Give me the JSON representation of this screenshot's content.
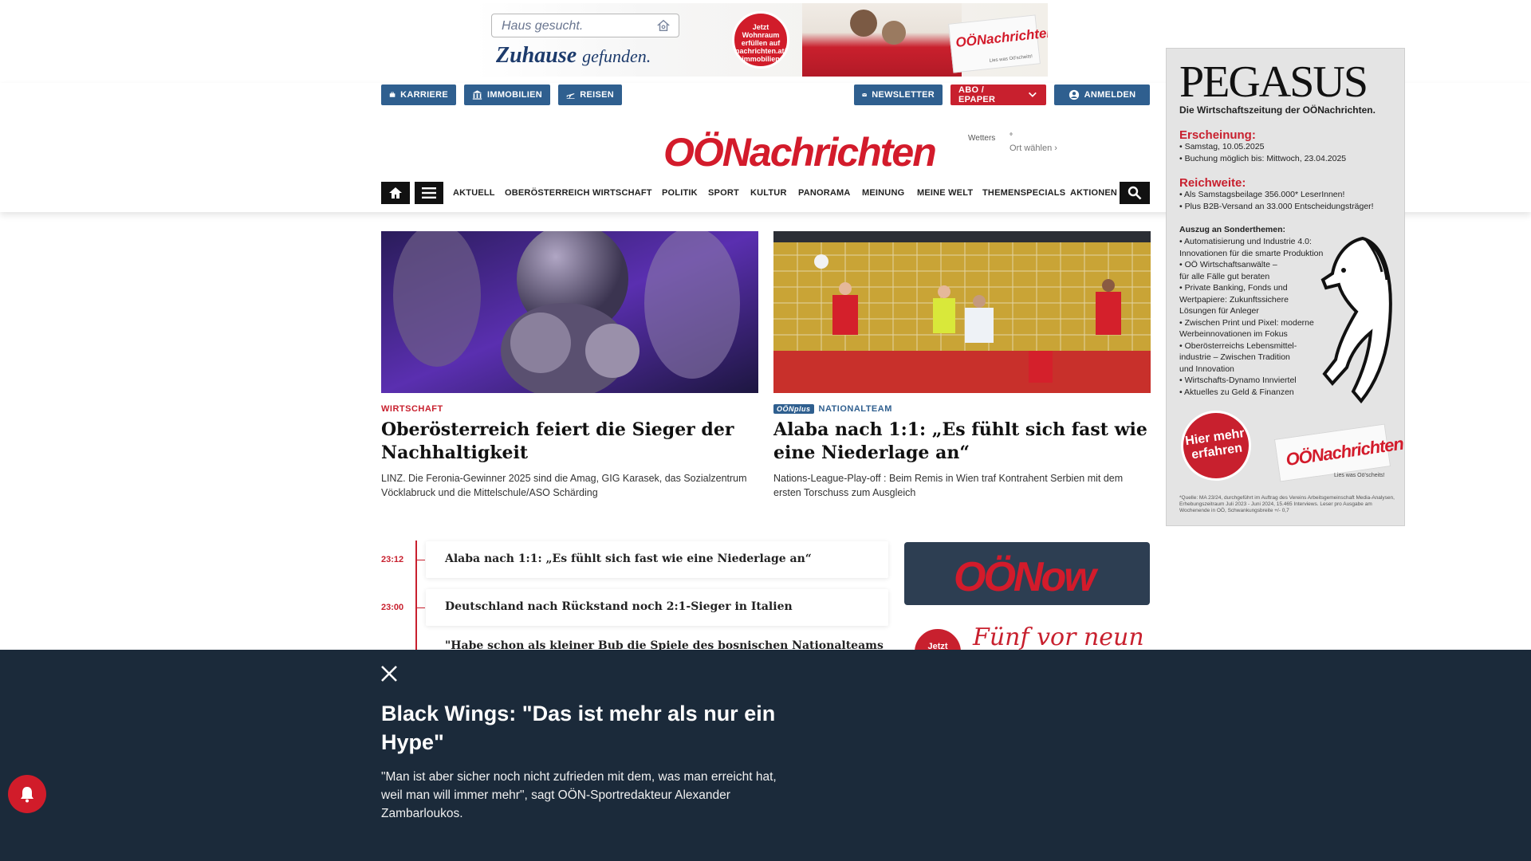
{
  "top_ad": {
    "search_placeholder": "Haus gesucht.",
    "slogan_main": "Zuhause",
    "slogan_tail": "gefunden.",
    "stamp_text": "Jetzt Wohnraum erfüllen auf nachrichten.at/ immobilien",
    "paper_logo": "OÖNachrichten",
    "paper_tag": "Lies was Oö'scheits!"
  },
  "header": {
    "left_buttons": [
      {
        "label": "KARRIERE",
        "icon": "briefcase-icon"
      },
      {
        "label": "IMMOBILIEN",
        "icon": "bank-icon"
      },
      {
        "label": "REISEN",
        "icon": "airplane-icon"
      }
    ],
    "right_buttons": [
      {
        "label": "NEWSLETTER",
        "icon": "mail-icon"
      },
      {
        "label": "ABO / EPAPER",
        "icon": "chevron-down-icon"
      },
      {
        "label": "ANMELDEN",
        "icon": "user-icon"
      }
    ],
    "logo": "OÖNachrichten",
    "weather": {
      "image_alt": "Wetters",
      "degrees": "°",
      "location": "Ort wählen"
    }
  },
  "nav": {
    "items": [
      "AKTUELL",
      "OBERÖSTERREICH",
      "WIRTSCHAFT",
      "POLITIK",
      "SPORT",
      "KULTUR",
      "PANORAMA",
      "MEINUNG",
      "MEINE WELT",
      "THEMENSPECIALS",
      "AKTIONEN"
    ]
  },
  "articles": [
    {
      "category": "WIRTSCHAFT",
      "title": "Oberösterreich feiert die Sieger der Nachhaltigkeit",
      "teaser": "LINZ. Die Feronia-Gewinner 2025 sind die Amag, GIG Karasek, das Sozialzentrum Vöcklabruck und die Mittelschule/ASO Schärding"
    },
    {
      "badge": "OÖNplus",
      "category": "NATIONALTEAM",
      "title": "Alaba nach 1:1: „Es fühlt sich fast wie eine Niederlage an“",
      "teaser": "Nations-League-Play-off : Beim Remis in Wien traf Kontrahent Serbien mit dem ersten Torschuss zum Ausgleich"
    }
  ],
  "timeline": [
    {
      "time": "23:12",
      "headline": "Alaba nach 1:1: „Es fühlt sich fast wie eine Niederlage an“"
    },
    {
      "time": "23:00",
      "headline": "Deutschland nach Rückstand noch 2:1-Sieger in Italien"
    },
    {
      "time": "",
      "headline": "\"Habe schon als kleiner Bub die Spiele des bosnischen Nationalteams"
    }
  ],
  "side": {
    "oenow": "OÖNow",
    "fvn_badge": "Jetzt",
    "fvn_title": "Fünf vor neun"
  },
  "sky_ad": {
    "title": "PEGASUS",
    "subtitle": "Die Wirtschaftszeitung der OÖNachrichten.",
    "h_erscheinung": "Erscheinung:",
    "erscheinung": [
      "• Samstag, 10.05.2025",
      "• Buchung möglich bis: Mittwoch, 23.04.2025"
    ],
    "h_reichweite": "Reichweite:",
    "reichweite": [
      "• Als Samstagsbeilage 356.000* LeserInnen!",
      "• Plus B2B-Versand an 33.000 Entscheidungsträger!"
    ],
    "h_themen": "Auszug an Sonderthemen:",
    "themen": [
      "• Automatisierung und Industrie 4.0:",
      "   Innovationen für die smarte Produktion",
      "• OÖ Wirtschaftsanwälte –",
      "   für alle Fälle gut beraten",
      "• Private Banking, Fonds und",
      "   Wertpapiere: Zukunftssichere",
      "   Lösungen für Anleger",
      "• Zwischen Print und Pixel: moderne",
      "   Werbeinnovationen im Fokus",
      "• Oberösterreichs Lebensmittel-",
      "   industrie – Zwischen Tradition",
      "   und Innovation",
      "• Wirtschafts-Dynamo Innviertel",
      "• Aktuelles zu Geld & Finanzen"
    ],
    "cta": "Hier mehr erfahren",
    "paper_logo": "OÖNachrichten",
    "paper_tag": "Lies was Oö'scheits!",
    "fine": "*Quelle: MA 23/24, durchgeführt im Auftrag des Vereins Arbeitsgemeinschaft Media-Analysen, Erhebungszeitraum Juli 2023 - Juni 2024, 15.465 Interviews. Leser pro Ausgabe am Wochenende in OÖ, Schwankungsbreite +/- 0,7"
  },
  "overlay": {
    "title": "Black Wings: \"Das ist mehr als nur ein Hype\"",
    "text": "\"Man ist aber sicher noch nicht zufrieden mit dem, was man erreicht hat, weil man will immer mehr\", sagt OÖN-Sportredakteur Alexander Zambarloukos."
  }
}
